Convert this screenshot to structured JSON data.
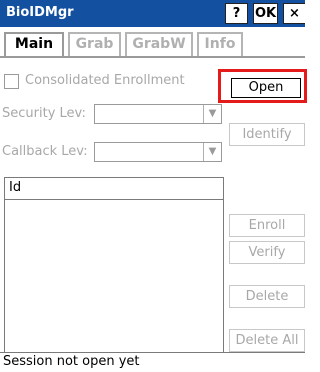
{
  "window": {
    "title": "BioIDMgr",
    "help_label": "?",
    "ok_label": "OK",
    "close_label": "×"
  },
  "tabs": [
    {
      "label": "Main",
      "active": true
    },
    {
      "label": "Grab",
      "active": false
    },
    {
      "label": "GrabW",
      "active": false
    },
    {
      "label": "Info",
      "active": false
    }
  ],
  "main": {
    "consolidated_label": "Consolidated Enrollment",
    "consolidated_checked": false,
    "security_label": "Security Lev:",
    "security_value": "",
    "callback_label": "Callback Lev:",
    "callback_value": "",
    "list_header": "Id",
    "list_items": []
  },
  "buttons": {
    "open": "Open",
    "identify": "Identify",
    "enroll": "Enroll",
    "verify": "Verify",
    "delete": "Delete",
    "delete_all": "Delete All"
  },
  "status": "Session not open yet",
  "colors": {
    "titlebar": "#1450a0",
    "highlight": "#e51b1b",
    "disabled_text": "#a8a8a8"
  }
}
